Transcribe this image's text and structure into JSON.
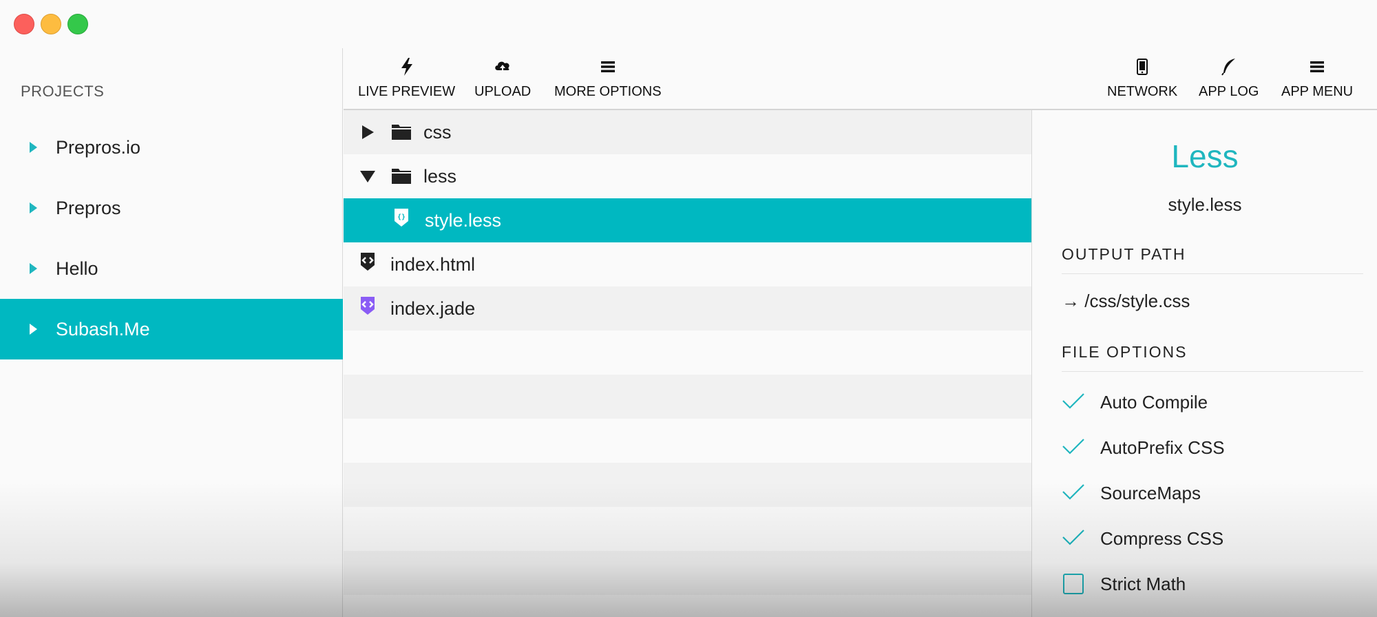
{
  "window": {
    "traffic_lights": [
      "close",
      "minimize",
      "zoom"
    ]
  },
  "sidebar": {
    "title": "PROJECTS",
    "projects": [
      {
        "label": "Prepros.io",
        "active": false
      },
      {
        "label": "Prepros",
        "active": false
      },
      {
        "label": "Hello",
        "active": false
      },
      {
        "label": "Subash.Me",
        "active": true
      }
    ]
  },
  "toolbar": {
    "left": [
      {
        "label": "LIVE PREVIEW",
        "icon": "bolt-icon"
      },
      {
        "label": "UPLOAD",
        "icon": "cloud-upload-icon"
      },
      {
        "label": "MORE OPTIONS",
        "icon": "menu-icon"
      }
    ],
    "right": [
      {
        "label": "NETWORK",
        "icon": "mobile-icon"
      },
      {
        "label": "APP LOG",
        "icon": "feather-icon"
      },
      {
        "label": "APP MENU",
        "icon": "menu-icon"
      }
    ]
  },
  "tree": {
    "rows": [
      {
        "name": "css",
        "kind": "folder",
        "expanded": false
      },
      {
        "name": "less",
        "kind": "folder",
        "expanded": true
      },
      {
        "name": "style.less",
        "kind": "less-file",
        "selected": true
      },
      {
        "name": "index.html",
        "kind": "html-file"
      },
      {
        "name": "index.jade",
        "kind": "jade-file"
      }
    ]
  },
  "panel": {
    "file_type": "Less",
    "file_name": "style.less",
    "output_heading": "OUTPUT  PATH",
    "output_path": "→ /css/style.css",
    "options_heading": "FILE  OPTIONS",
    "options": [
      {
        "label": "Auto Compile",
        "checked": true
      },
      {
        "label": "AutoPrefix CSS",
        "checked": true
      },
      {
        "label": "SourceMaps",
        "checked": true
      },
      {
        "label": "Compress CSS",
        "checked": true
      },
      {
        "label": "Strict Math",
        "checked": false
      }
    ]
  },
  "colors": {
    "accent": "#00b8c1",
    "accent_text": "#1fb6bf",
    "jade": "#8a5cf5"
  }
}
